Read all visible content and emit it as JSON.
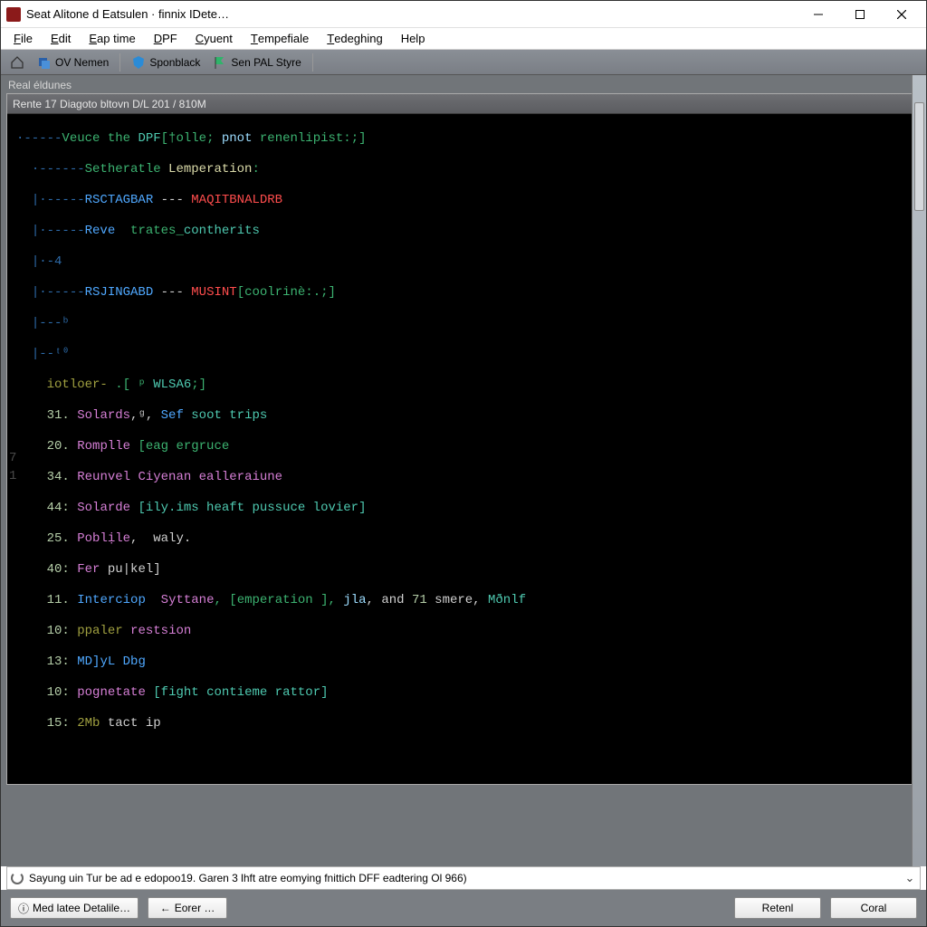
{
  "window": {
    "title": "Seat Alitone d Eatsulen · finnix IDete…"
  },
  "menu": {
    "file": {
      "label": "File",
      "ul": "F",
      "rest": "ile"
    },
    "edit": {
      "label": "Edit",
      "ul": "E",
      "rest": "dit"
    },
    "eaptime": {
      "label": "Eap time",
      "ul": "E",
      "rest": "ap time"
    },
    "dpf": {
      "label": "DPF",
      "ul": "D",
      "rest": "PF"
    },
    "cyuent": {
      "label": "Cyuent",
      "ul": "C",
      "rest": "yuent"
    },
    "tempe": {
      "label": "Tempefiale",
      "ul": "T",
      "rest": "empefiale"
    },
    "tedeg": {
      "label": "Tedeghing",
      "ul": "T",
      "rest": "edeghing"
    },
    "help": {
      "label": "Help",
      "ul": "H",
      "rest": "elp"
    }
  },
  "toolbar": {
    "ov_nemen": "OV Nemen",
    "sponblack": "Sponblack",
    "sen_pal": "Sen PAL Styre"
  },
  "section_label": "Real éldunes",
  "panel_header": "Rente 17 Diagoto bltovn D/L 201 / 810M",
  "code": {
    "l1": {
      "guide": "·-----",
      "c1": "Veuce the ",
      "c2": "DPF",
      "c3": "[†olle; ",
      "c4": "pnot",
      "c5": " renenlipist:;]"
    },
    "l2": {
      "guide": "·------",
      "c1": "Setheratle ",
      "c2": "Lemperation",
      "c3": ":"
    },
    "l3": {
      "guide": "|·-----",
      "c1": "RSCTAGBAR",
      "c2": " --- ",
      "c3": "MAQITBNALDRB"
    },
    "l4": {
      "guide": "|·-----",
      "c1": "Reve",
      "c2": "  trates_",
      "c3": "contherits"
    },
    "l5": {
      "guide": "|·-4"
    },
    "l6": {
      "guide": "|·-----",
      "c1": "RSJINGABD",
      "c2": " --- ",
      "c3": "MUSINT",
      "c4": "[coolrinè:.;]"
    },
    "l7": {
      "guide": "|---ᵇ"
    },
    "l8": {
      "guide": "|--ᵗ⁰"
    },
    "l9": {
      "guide": "·",
      "pre": "iotloer- ",
      "mid": ".[ ᵖ ",
      "name": "WLSA6",
      "tail": ";]"
    },
    "n31": {
      "no": "31.",
      "a": "Solards",
      "b": ",ᵍ, ",
      "c": "Sef",
      "d": " soot trips"
    },
    "n20": {
      "no": "20.",
      "a": "Romplle",
      "b": " [eag ergruce"
    },
    "n34": {
      "no": "34.",
      "a": "Reunvel",
      "b": " Ciyenan ealleraiune"
    },
    "n44": {
      "no": "44:",
      "a": "Solarde",
      "b": " [ily.ims heaft pussuce lovier]"
    },
    "n25": {
      "no": "25.",
      "a": "Poblịle",
      "b": ",  waly."
    },
    "n40": {
      "no": "40:",
      "a": "Fer",
      "b": " pu|kel]"
    },
    "n11": {
      "no": "11.",
      "a": "Interciop",
      "b": "  Syttane",
      "c": ", [emperation ], ",
      "d": "jla",
      "e": ", and ",
      "f": "71",
      "g": " smere, ",
      "h": "Mðnlf"
    },
    "n10": {
      "no": "10:",
      "a": "ppaler",
      "b": " restsion"
    },
    "n13": {
      "no": "13:",
      "a": "MD]yL",
      "b": " Dbg"
    },
    "n10b": {
      "no": "10:",
      "a": "pognetate",
      "b": " [fight contieme rattor]"
    },
    "n15": {
      "no": "15:",
      "a": "2Mb",
      "b": " tact ip"
    },
    "gutter7": "7",
    "gutter1": "1"
  },
  "status": {
    "text": "Sayung uin Tur be ad e edopoo19. Garen 3 lhft atre eomying fnittich DFF eadtering Ol 966)"
  },
  "buttons": {
    "details": "Med latee Detalile…",
    "eorer": "Eorer …",
    "retenl": "Retenl",
    "coral": "Coral"
  }
}
